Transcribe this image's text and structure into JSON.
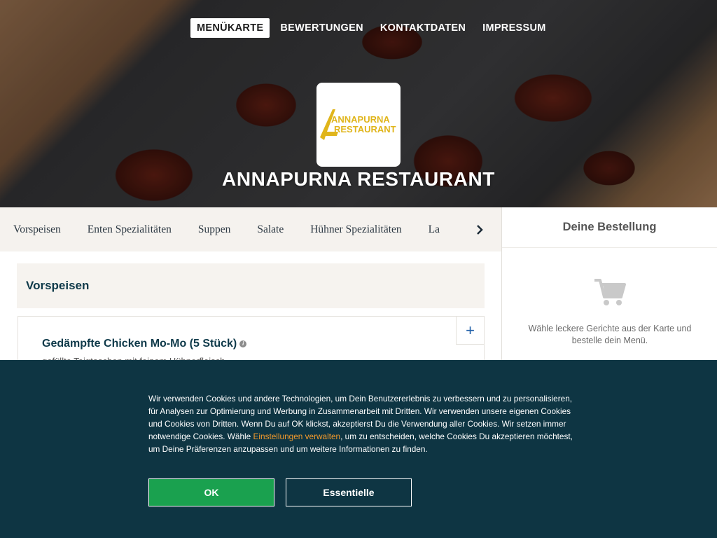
{
  "nav": {
    "items": [
      {
        "label": "MENÜKARTE",
        "active": true
      },
      {
        "label": "BEWERTUNGEN",
        "active": false
      },
      {
        "label": "KONTAKTDATEN",
        "active": false
      },
      {
        "label": "IMPRESSUM",
        "active": false
      }
    ]
  },
  "restaurant": {
    "name": "ANNAPURNA RESTAURANT",
    "logo_text_line1": "ANNAPURNA",
    "logo_text_line2": "RESTAURANT",
    "logo_color": "#e0b51b"
  },
  "categories": [
    "Vorspeisen",
    "Enten Spezialitäten",
    "Suppen",
    "Salate",
    "Hühner Spezialitäten",
    "La"
  ],
  "main": {
    "section_title": "Vorspeisen",
    "dish": {
      "name": "Gedämpfte Chicken Mo-Mo (5 Stück)",
      "description": "gefüllte Teigtaschen mit feinem Hühnerfleisch",
      "add_label": "+"
    }
  },
  "sidebar": {
    "title": "Deine Bestellung",
    "empty_text": "Wähle leckere Gerichte aus der Karte und bestelle dein Menü."
  },
  "cookie": {
    "text_before": "Wir verwenden Cookies und andere Technologien, um Dein Benutzererlebnis zu verbessern und zu personalisieren, für Analysen zur Optimierung und Werbung in Zusammenarbeit mit Dritten. Wir verwenden unsere eigenen Cookies und Cookies von Dritten. Wenn Du auf OK klickst, akzeptierst Du die Verwendung aller Cookies. Wir setzen immer notwendige Cookies. Wähle ",
    "link_text": "Einstellungen verwalten",
    "text_after": ", um zu entscheiden, welche Cookies Du akzeptieren möchtest, um Deine Präferenzen anzupassen und um weitere Informationen zu finden.",
    "ok_label": "OK",
    "essential_label": "Essentielle"
  },
  "colors": {
    "brand_dark": "#0e3543",
    "ok_green": "#1aa14f",
    "link_orange": "#f39a2c",
    "plus_blue": "#1f5fa8"
  }
}
